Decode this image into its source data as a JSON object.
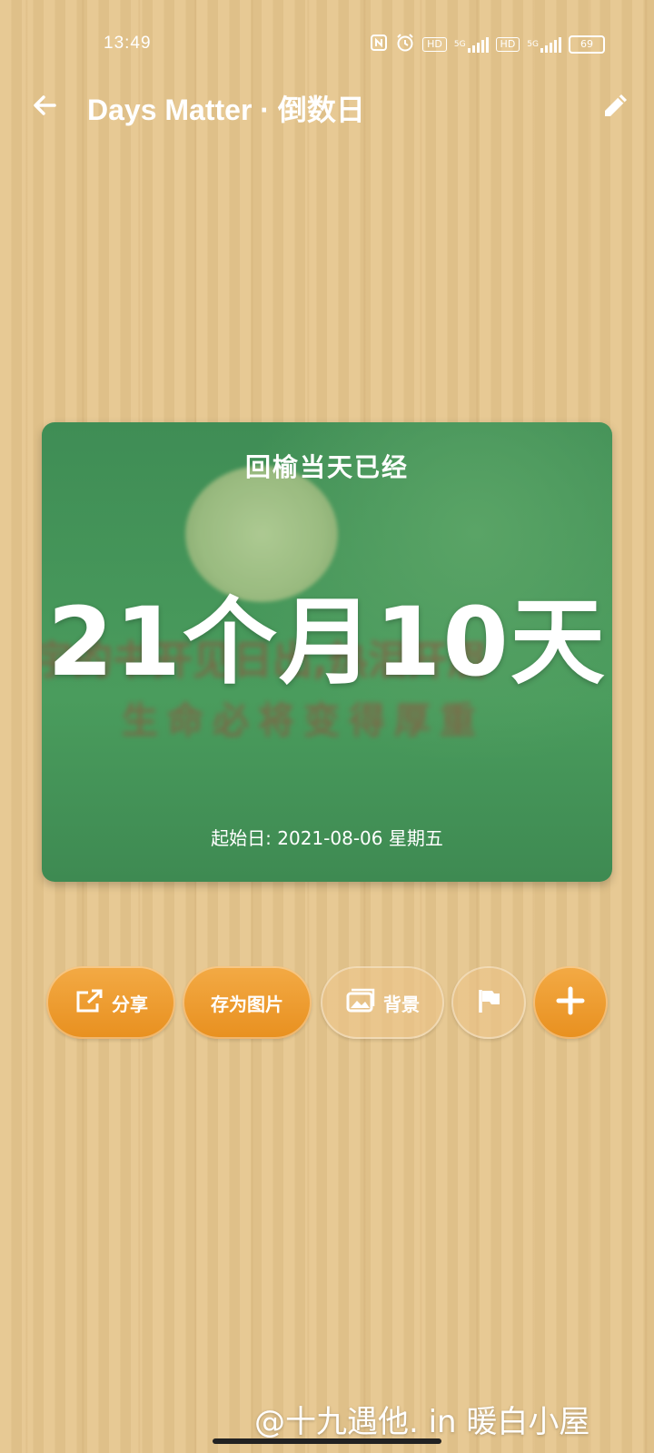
{
  "status_bar": {
    "time": "13:49",
    "network_1": "5G",
    "hd_1": "HD",
    "network_2": "5G",
    "hd_2": "HD",
    "battery": "69"
  },
  "header": {
    "title": "Days Matter · 倒数日",
    "back_icon": "arrow-left-icon",
    "edit_icon": "pencil-icon"
  },
  "card": {
    "subtitle": "回榆当天已经",
    "duration": "21个月10天",
    "start_date": "起始日: 2021-08-06 星期五",
    "background_text_line1": "宇的书开见日出,热泪开眉",
    "background_text_line2": "生命必将变得厚重"
  },
  "actions": {
    "share_label": "分享",
    "save_image_label": "存为图片",
    "background_label": "背景",
    "flag_icon": "flag-icon",
    "add_icon": "plus-icon"
  },
  "watermark": "@十九遇他. in 暖白小屋",
  "colors": {
    "accent_orange": "#ee9a2e",
    "card_green": "#44955a"
  }
}
